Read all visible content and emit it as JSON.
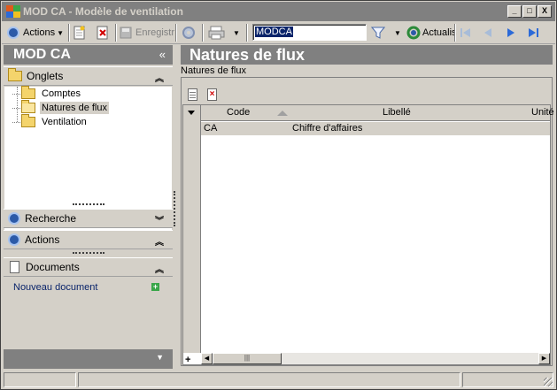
{
  "window": {
    "title": "MOD CA - Modèle de ventilation",
    "buttons": [
      "_",
      "□",
      "X"
    ]
  },
  "toolbar": {
    "actions_label": "Actions",
    "save_label": "Enregistr",
    "combo_value": "MODCA",
    "refresh_label": "Actualis",
    "icons": [
      "actions-icon",
      "new-icon",
      "delete-icon",
      "save-icon",
      "refresh-gear-icon",
      "print-icon",
      "filter-icon",
      "refresh-icon",
      "first-icon",
      "previous-icon",
      "next-icon",
      "last-icon"
    ]
  },
  "sidebar": {
    "title": "MOD CA",
    "collapse_glyph": "«",
    "sections": {
      "onglets": "Onglets",
      "recherche": "Recherche",
      "actions": "Actions",
      "documents": "Documents"
    },
    "tree": [
      {
        "label": "Comptes",
        "selected": false
      },
      {
        "label": "Natures de flux",
        "selected": true
      },
      {
        "label": "Ventilation",
        "selected": false
      }
    ],
    "new_document": "Nouveau document"
  },
  "main": {
    "title": "Natures de flux",
    "group_label": "Natures de flux",
    "grid": {
      "columns": [
        "Code",
        "Libellé",
        "Unité"
      ],
      "rows": [
        {
          "code": "CA",
          "libelle": "Chiffre d'affaires",
          "unite": ""
        }
      ],
      "add_glyph": "+"
    }
  },
  "colors": {
    "header_gray": "#808080",
    "face": "#d4d0c8",
    "selection": "#0a246a",
    "link": "#0a246a",
    "nav_blue": "#2c6ad8"
  }
}
